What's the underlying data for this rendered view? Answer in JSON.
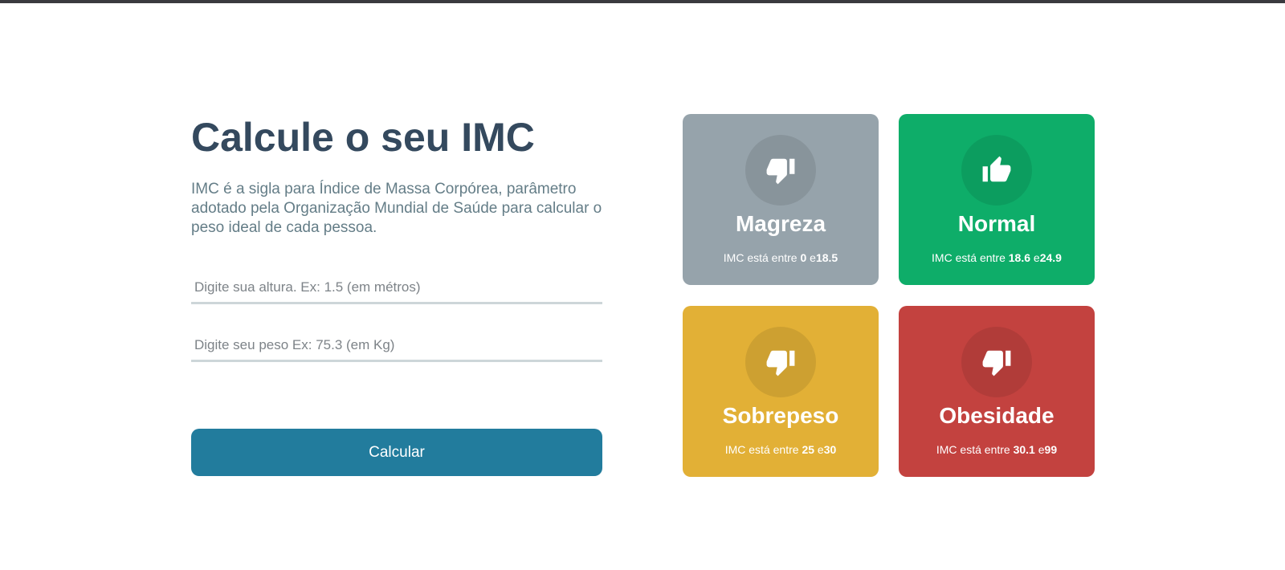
{
  "page": {
    "title": "Calcule o seu IMC",
    "description": "IMC é a sigla para Índice de Massa Corpórea, parâmetro adotado pela Organização Mundial de Saúde para calcular o peso ideal de cada pessoa."
  },
  "form": {
    "height_placeholder": "Digite sua altura. Ex: 1.5 (em métros)",
    "weight_placeholder": "Digite seu peso Ex: 75.3 (em Kg)",
    "height_value": "",
    "weight_value": "",
    "button_label": "Calcular"
  },
  "cards": [
    {
      "title": "Magreza",
      "prefix": "IMC está entre",
      "min": "0",
      "sep": "e",
      "max": "18.5",
      "icon": "thumbs-down-icon",
      "color": "#96a3ab"
    },
    {
      "title": "Normal",
      "prefix": "IMC está entre",
      "min": "18.6",
      "sep": "e",
      "max": "24.9",
      "icon": "thumbs-up-icon",
      "color": "#0ead69"
    },
    {
      "title": "Sobrepeso",
      "prefix": "IMC está entre",
      "min": "25",
      "sep": "e",
      "max": "30",
      "icon": "thumbs-down-icon",
      "color": "#e2b036"
    },
    {
      "title": "Obesidade",
      "prefix": "IMC está entre",
      "min": "30.1",
      "sep": "e",
      "max": "99",
      "icon": "thumbs-down-icon",
      "color": "#c3423f"
    }
  ],
  "colors": {
    "title": "#34495e",
    "text": "#647d87",
    "button": "#227c9d",
    "input_border": "#cdd6d9"
  }
}
